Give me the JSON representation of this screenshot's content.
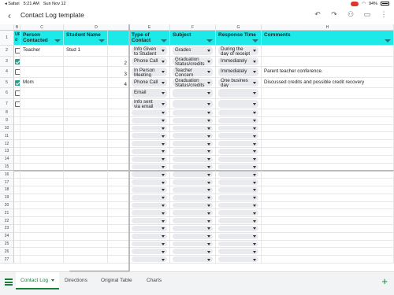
{
  "status": {
    "carrier": "◂ Safari",
    "time": "5:21 AM",
    "date": "Sun Nov 12",
    "battery": "94%"
  },
  "title": "Contact Log template",
  "toolbar_icons": [
    "undo-icon",
    "redo-icon",
    "add-person-icon",
    "comment-icon",
    "more-icon"
  ],
  "columns": [
    "B",
    "C",
    "D",
    "E",
    "F",
    "G",
    "H"
  ],
  "headers": {
    "updated": "UP\nd",
    "person": "Person\nContacted",
    "student": "Student Name",
    "type": "Type of\nContact",
    "subject": "Subject",
    "response": "Response Time",
    "comments": "Comments"
  },
  "rows": [
    {
      "n": "2",
      "cb": false,
      "person": "Teacher",
      "student": "Stud 1",
      "num": "",
      "type": "Info Given\nto Student",
      "subject": "Grades",
      "response": "During the\nday of receipt",
      "comments": ""
    },
    {
      "n": "3",
      "cb": true,
      "person": "",
      "student": "",
      "num": "2",
      "type": "Phone Call",
      "subject": "Graduation\nStatus/credits",
      "response": "Immediately",
      "comments": ""
    },
    {
      "n": "4",
      "cb": false,
      "person": "",
      "student": "",
      "num": "3",
      "type": "In Person\nMeeting",
      "subject": "Teacher\nConcern",
      "response": "Immediately",
      "comments": "Parent teacher conference."
    },
    {
      "n": "5",
      "cb": true,
      "person": "Mom",
      "student": "",
      "num": "4",
      "type": "Phone Call",
      "subject": "Graduation\nStatus/credits",
      "response": "One busines\nday",
      "comments": "Discussed credits and possible credit recovery"
    },
    {
      "n": "6",
      "cb": false,
      "person": "",
      "student": "",
      "num": "",
      "type": "Email",
      "subject": "",
      "response": "",
      "comments": ""
    },
    {
      "n": "7",
      "cb": false,
      "person": "",
      "student": "",
      "num": "",
      "type": "Info sent\nvia email",
      "subject": "",
      "response": "",
      "comments": ""
    },
    {
      "n": "8"
    },
    {
      "n": "9"
    },
    {
      "n": "10"
    },
    {
      "n": "11"
    },
    {
      "n": "12"
    },
    {
      "n": "13"
    },
    {
      "n": "14"
    },
    {
      "n": "15"
    },
    {
      "n": "16"
    },
    {
      "n": "17"
    },
    {
      "n": "18"
    },
    {
      "n": "19"
    },
    {
      "n": "20"
    },
    {
      "n": "21"
    },
    {
      "n": "22"
    },
    {
      "n": "23"
    },
    {
      "n": "24"
    },
    {
      "n": "25"
    },
    {
      "n": "26"
    },
    {
      "n": "27"
    }
  ],
  "header_row_num": "1",
  "sheets": [
    {
      "label": "Contact Log",
      "active": true
    },
    {
      "label": "Directions",
      "active": false
    },
    {
      "label": "Original Table",
      "active": false
    },
    {
      "label": "Charts",
      "active": false
    }
  ],
  "add_sheet": "+",
  "colors": {
    "header_fill": "#1de9e9",
    "accent": "#188038",
    "checkbox": "#2a9d8f"
  }
}
